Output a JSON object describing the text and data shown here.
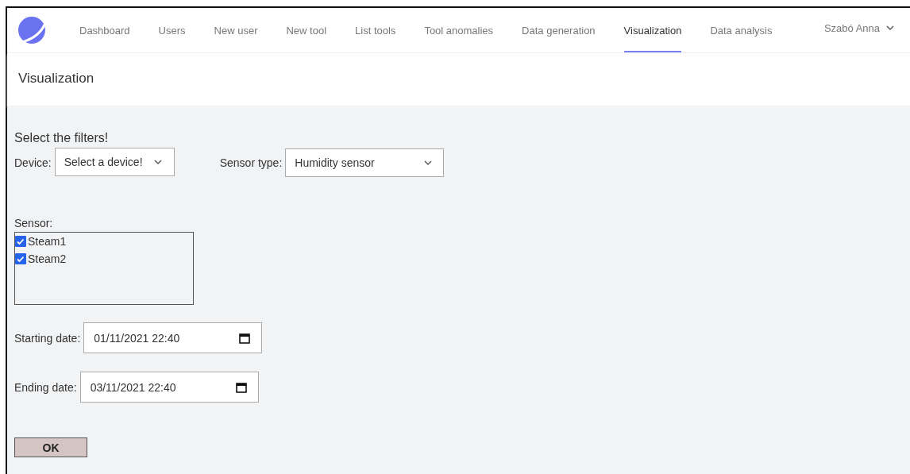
{
  "nav": {
    "items": [
      {
        "label": "Dashboard",
        "selected": false
      },
      {
        "label": "Users",
        "selected": false
      },
      {
        "label": "New user",
        "selected": false
      },
      {
        "label": "New tool",
        "selected": false
      },
      {
        "label": "List tools",
        "selected": false
      },
      {
        "label": "Tool anomalies",
        "selected": false
      },
      {
        "label": "Data generation",
        "selected": false
      },
      {
        "label": "Visualization",
        "selected": true
      },
      {
        "label": "Data analysis",
        "selected": false
      }
    ],
    "user": "Szabó Anna"
  },
  "page_title": "Visualization",
  "form": {
    "heading": "Select the filters!",
    "device": {
      "label": "Device:",
      "value": "Select a device!"
    },
    "sensor_type": {
      "label": "Sensor type:",
      "value": "Humidity sensor"
    },
    "sensor": {
      "label": "Sensor:",
      "options": [
        {
          "label": "Steam1",
          "checked": true
        },
        {
          "label": "Steam2",
          "checked": true
        }
      ]
    },
    "starting_date": {
      "label": "Starting date:",
      "value": "01/11/2021 22:40"
    },
    "ending_date": {
      "label": "Ending date:",
      "value": "03/11/2021 22:40"
    },
    "submit": "OK"
  }
}
